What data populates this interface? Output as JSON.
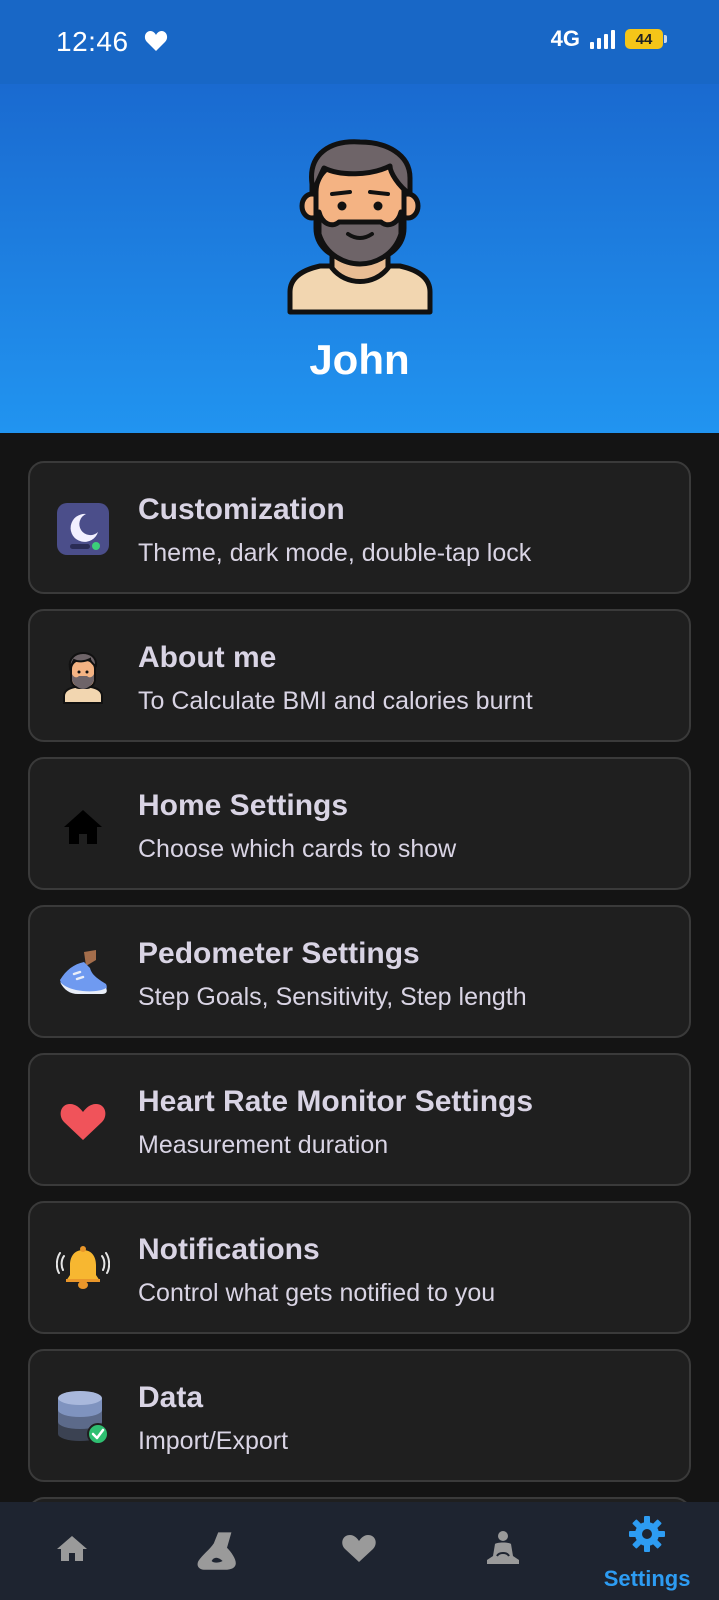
{
  "status_bar": {
    "time": "12:46",
    "network": "4G",
    "battery": "44"
  },
  "profile": {
    "name": "John"
  },
  "settings": [
    {
      "title": "Customization",
      "subtitle": "Theme, dark mode, double-tap lock",
      "icon": "theme-moon-icon"
    },
    {
      "title": "About me",
      "subtitle": "To Calculate BMI and calories burnt",
      "icon": "avatar-icon"
    },
    {
      "title": "Home Settings",
      "subtitle": "Choose which cards to show",
      "icon": "home-icon"
    },
    {
      "title": "Pedometer Settings",
      "subtitle": "Step Goals, Sensitivity, Step length",
      "icon": "sneaker-icon"
    },
    {
      "title": "Heart Rate Monitor Settings",
      "subtitle": "Measurement duration",
      "icon": "heart-icon"
    },
    {
      "title": "Notifications",
      "subtitle": "Control what gets notified to you",
      "icon": "bell-icon"
    },
    {
      "title": "Data",
      "subtitle": "Import/Export",
      "icon": "database-icon"
    }
  ],
  "bottom_nav": {
    "items": [
      {
        "icon": "home-icon"
      },
      {
        "icon": "footprint-icon"
      },
      {
        "icon": "heart-icon"
      },
      {
        "icon": "meditation-icon"
      },
      {
        "icon": "gear-icon",
        "label": "Settings",
        "active": true
      }
    ]
  },
  "colors": {
    "header_top": "#1a6ad0",
    "header_bottom": "#2194f0",
    "background": "#141414",
    "card": "#1f1f1f",
    "active_nav": "#2d9cf2"
  }
}
